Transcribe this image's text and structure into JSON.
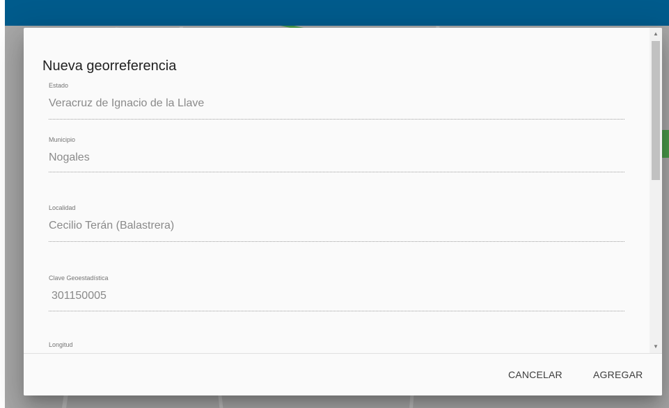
{
  "dialog": {
    "title": "Nueva georreferencia",
    "fields": [
      {
        "label": "Estado",
        "value": "Veracruz de Ignacio de la Llave"
      },
      {
        "label": "Municipio",
        "value": "Nogales"
      },
      {
        "label": "Localidad",
        "value": "Cecilio Terán (Balastrera)"
      },
      {
        "label": "Clave Geoestadística",
        "value": "301150005"
      },
      {
        "label": "Longitud",
        "value": ""
      }
    ],
    "actions": {
      "cancel_label": "CANCELAR",
      "add_label": "AGREGAR"
    }
  },
  "scrollbar": {
    "up_icon": "▲",
    "down_icon": "▼"
  },
  "colors": {
    "topbar": "#005b8c",
    "dialog_bg": "#fafafa",
    "label": "#757575",
    "value": "#8a8a8a"
  }
}
